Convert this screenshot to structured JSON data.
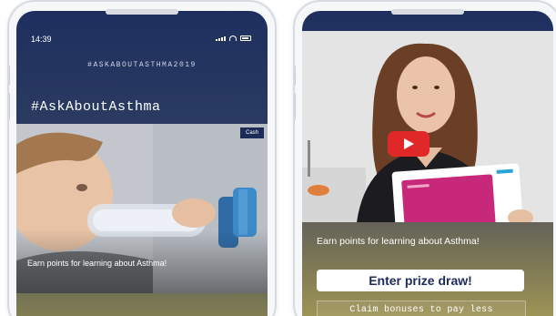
{
  "left_screen": {
    "status_time": "14:39",
    "campaign_tag": "#ASKABOUTASTHMA2019",
    "hashtag_title": "#AskAboutAsthma",
    "photo_badge": "Cash",
    "photo_caption": "Earn points for learning about Asthma!"
  },
  "right_screen": {
    "earn_text": "Earn points for learning about Asthma!",
    "prize_button_label": "Enter prize draw!",
    "claim_text": "Claim bonuses to pay less",
    "colors": {
      "header_navy": "#1e2f5f",
      "gold": "#a59a56",
      "play_red": "#e02828",
      "card_magenta": "#c8287a"
    }
  }
}
